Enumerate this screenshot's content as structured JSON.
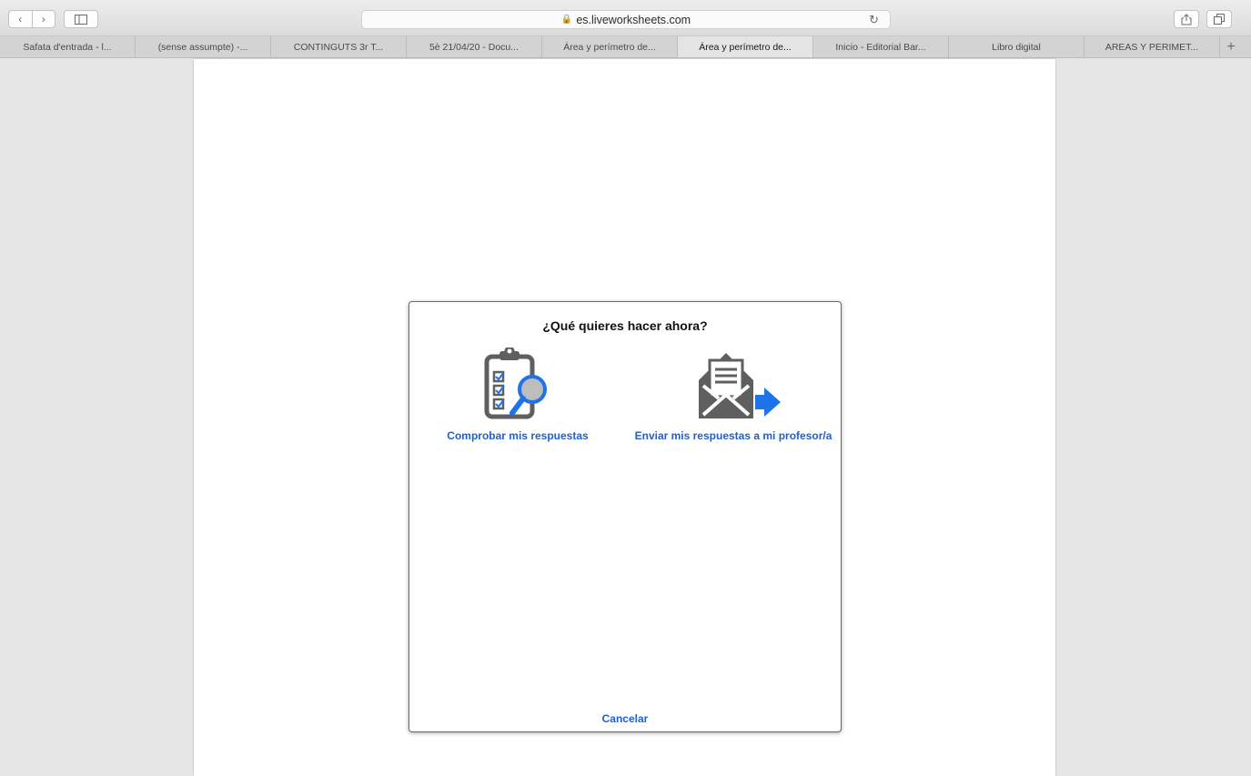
{
  "browser": {
    "url": "es.liveworksheets.com",
    "tabs": [
      {
        "label": "Safata d'entrada - l...",
        "active": false
      },
      {
        "label": "(sense assumpte) -...",
        "active": false
      },
      {
        "label": "CONTINGUTS 3r T...",
        "active": false
      },
      {
        "label": "5è 21/04/20 - Docu...",
        "active": false
      },
      {
        "label": "Área y perímetro de...",
        "active": false
      },
      {
        "label": "Área y perímetro de...",
        "active": true
      },
      {
        "label": "Inicio - Editorial Bar...",
        "active": false
      },
      {
        "label": "Libro digital",
        "active": false
      },
      {
        "label": "AREAS Y PERIMET...",
        "active": false
      }
    ]
  },
  "dialog": {
    "title": "¿Qué quieres hacer ahora?",
    "check_label": "Comprobar mis respuestas",
    "send_label": "Enviar mis respuestas a mi profesor/a",
    "cancel_label": "Cancelar"
  },
  "colors": {
    "link": "#1f5fcf",
    "icon_gray": "#5f5f5f",
    "icon_blue": "#1e73e8"
  }
}
